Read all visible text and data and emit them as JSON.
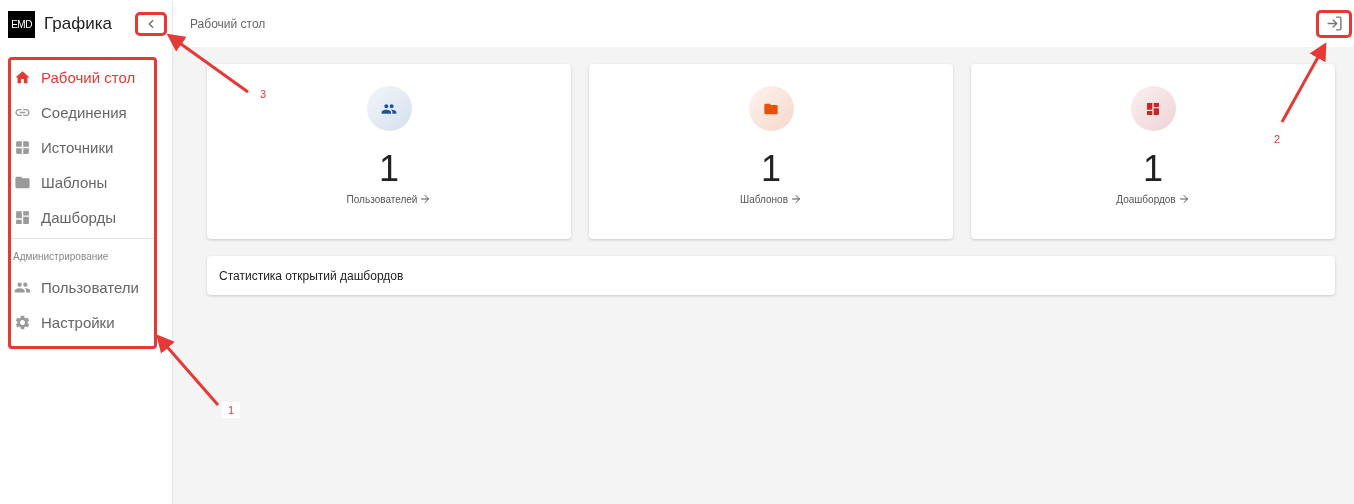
{
  "sidebar": {
    "logo_text": "EMD",
    "title": "Графика",
    "collapse_button": {
      "highlighted": true
    },
    "nav": {
      "highlighted": true,
      "items": [
        {
          "label": "Рабочий стол",
          "kind": "home",
          "selected": true
        },
        {
          "label": "Соединения",
          "kind": "link",
          "selected": false
        },
        {
          "label": "Источники",
          "kind": "grid",
          "selected": false
        },
        {
          "label": "Шаблоны",
          "kind": "folder",
          "selected": false
        },
        {
          "label": "Дашборды",
          "kind": "dashboard",
          "selected": false
        }
      ],
      "section_title": "Администрирование",
      "admin_items": [
        {
          "label": "Пользователи",
          "kind": "users",
          "selected": false
        },
        {
          "label": "Настройки",
          "kind": "settings",
          "selected": false
        }
      ]
    }
  },
  "header": {
    "breadcrumb": "Рабочий стол",
    "logout_button": {
      "highlighted": true
    }
  },
  "cards": [
    {
      "kind": "users",
      "value": "1",
      "link": "Пользователей"
    },
    {
      "kind": "folder",
      "value": "1",
      "link": "Шаблонов"
    },
    {
      "kind": "dashboard",
      "value": "1",
      "link": "Доашбордов"
    }
  ],
  "stats_panel": {
    "title": "Статистика открытий дашбордов"
  },
  "annotations": [
    {
      "label": "1"
    },
    {
      "label": "2"
    },
    {
      "label": "3"
    }
  ]
}
